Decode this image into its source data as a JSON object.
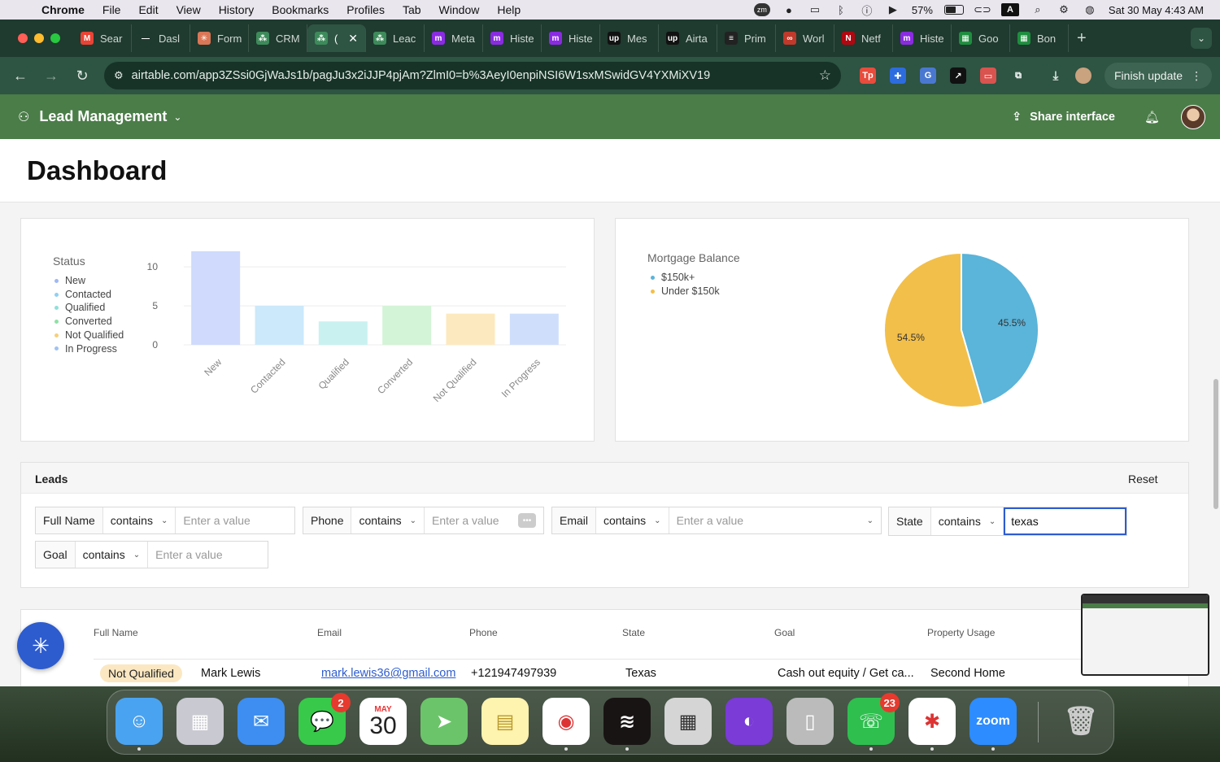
{
  "menubar": {
    "app": "Chrome",
    "items": [
      "File",
      "Edit",
      "View",
      "History",
      "Bookmarks",
      "Profiles",
      "Tab",
      "Window",
      "Help"
    ],
    "battery": "57%",
    "input_source": "A",
    "datetime": "Sat 30 May  4:43 AM",
    "zm_label": "zm"
  },
  "tabs": [
    {
      "label": "Sear",
      "icon": "gmail-icon",
      "color": "#ea4335",
      "glyph": "M"
    },
    {
      "label": "Dasl",
      "icon": "dash-icon",
      "color": "#1f3a2f",
      "glyph": "—"
    },
    {
      "label": "Form",
      "icon": "claude-icon",
      "color": "#d97757",
      "glyph": "✳"
    },
    {
      "label": "CRM",
      "icon": "airtable-icon",
      "color": "#3d8a5a",
      "glyph": "⁂"
    },
    {
      "label": "(",
      "icon": "airtable-icon",
      "color": "#3d8a5a",
      "glyph": "⁂",
      "active": true
    },
    {
      "label": "Leac",
      "icon": "airtable-icon",
      "color": "#3d8a5a",
      "glyph": "⁂"
    },
    {
      "label": "Meta",
      "icon": "make-icon",
      "color": "#8a2be2",
      "glyph": "m"
    },
    {
      "label": "Histe",
      "icon": "make-icon",
      "color": "#8a2be2",
      "glyph": "m"
    },
    {
      "label": "Histe",
      "icon": "make-icon",
      "color": "#8a2be2",
      "glyph": "m"
    },
    {
      "label": "Mes",
      "icon": "upwork-icon",
      "color": "#111",
      "glyph": "up"
    },
    {
      "label": "Airta",
      "icon": "upwork-icon",
      "color": "#111",
      "glyph": "up"
    },
    {
      "label": "Prim",
      "icon": "prime-icon",
      "color": "#222",
      "glyph": "≡"
    },
    {
      "label": "Worl",
      "icon": "link-icon",
      "color": "#c0392b",
      "glyph": "∞"
    },
    {
      "label": "Netf",
      "icon": "netflix-icon",
      "color": "#b20710",
      "glyph": "N"
    },
    {
      "label": "Histe",
      "icon": "make-icon",
      "color": "#8a2be2",
      "glyph": "m"
    },
    {
      "label": "Goo",
      "icon": "sheets-icon",
      "color": "#1e8e3e",
      "glyph": "▦"
    },
    {
      "label": "Bon",
      "icon": "sheets-icon",
      "color": "#1e8e3e",
      "glyph": "▦"
    }
  ],
  "address": {
    "url": "airtable.com/app3ZSsi0GjWaJs1b/pagJu3x2iJJP4pjAm?ZlmI0=b%3AeyI0enpiNSI6W1sxMSwidGV4YXMiXV19",
    "finish_update": "Finish update"
  },
  "extensions": [
    {
      "name": "tp-extension-icon",
      "color": "#e74c3c",
      "glyph": "Tp"
    },
    {
      "name": "puzzle-blue-icon",
      "color": "#2d6cdf",
      "glyph": "✚"
    },
    {
      "name": "translate-icon",
      "color": "#4a78d0",
      "glyph": "G"
    },
    {
      "name": "cursor-extension-icon",
      "color": "#111",
      "glyph": "↗"
    },
    {
      "name": "red-square-extension-icon",
      "color": "#d9534f",
      "glyph": "▭"
    },
    {
      "name": "extensions-puzzle-icon",
      "color": "#2e5443",
      "glyph": "⧉"
    }
  ],
  "app": {
    "title": "Lead Management",
    "share_label": "Share interface"
  },
  "page": {
    "title": "Dashboard"
  },
  "chart_data": [
    {
      "type": "bar",
      "title": "",
      "legend_title": "Status",
      "categories": [
        "New",
        "Contacted",
        "Qualified",
        "Converted",
        "Not Qualified",
        "In Progress"
      ],
      "values": [
        12,
        5,
        3,
        5,
        4,
        4
      ],
      "colors": [
        "#cfdafc",
        "#cce9fb",
        "#c9f1f0",
        "#d3f4d6",
        "#fde9bf",
        "#cfdffb"
      ],
      "legend_colors": [
        "#9fb8f5",
        "#8fd0f3",
        "#8fe0d8",
        "#8fe0a5",
        "#f6cf7b",
        "#9fc2f3"
      ],
      "yticks": [
        0,
        5,
        10
      ],
      "ylim": [
        0,
        12
      ],
      "grid": true,
      "legend_position": "left"
    },
    {
      "type": "pie",
      "title": "",
      "legend_title": "Mortgage Balance",
      "labels": [
        "$150k+",
        "Under $150k"
      ],
      "values": [
        45.5,
        54.5
      ],
      "value_labels": [
        "45.5%",
        "54.5%"
      ],
      "colors": [
        "#5bb4d9",
        "#f2bf4a"
      ],
      "legend_position": "top-left"
    }
  ],
  "leads": {
    "section_title": "Leads",
    "reset_label": "Reset",
    "filters": [
      {
        "field": "Full Name",
        "operator": "contains",
        "value": "",
        "placeholder": "Enter a value"
      },
      {
        "field": "Phone",
        "operator": "contains",
        "value": "",
        "placeholder": "Enter a value"
      },
      {
        "field": "Email",
        "operator": "contains",
        "value": "",
        "placeholder": "Enter a value"
      },
      {
        "field": "State",
        "operator": "contains",
        "value": "texas",
        "placeholder": "Enter a value"
      },
      {
        "field": "Goal",
        "operator": "contains",
        "value": "",
        "placeholder": "Enter a value"
      }
    ],
    "columns": [
      "Full Name",
      "Email",
      "Phone",
      "State",
      "Goal",
      "Property Usage"
    ],
    "rows": [
      {
        "status": "Not Qualified",
        "full_name": "Mark Lewis",
        "email": "mark.lewis36@gmail.com",
        "phone": "+121947497939",
        "state": "Texas",
        "goal": "Cash out equity / Get ca...",
        "property_usage": "Second Home"
      }
    ]
  },
  "dock": [
    {
      "name": "finder",
      "bg": "#4aa3f0",
      "glyph": "☺",
      "running": true
    },
    {
      "name": "launchpad",
      "bg": "#c9c9d1",
      "glyph": "▦",
      "running": false
    },
    {
      "name": "mail",
      "bg": "#3d8ef0",
      "glyph": "✉",
      "running": false
    },
    {
      "name": "messages",
      "bg": "#38c94a",
      "glyph": "💬",
      "badge": "2",
      "running": false
    },
    {
      "name": "calendar",
      "bg": "#ffffff",
      "glyph": "",
      "month": "MAY",
      "day": "30",
      "running": false
    },
    {
      "name": "maps",
      "bg": "#6cc46a",
      "glyph": "➤",
      "running": false
    },
    {
      "name": "notes",
      "bg": "#fff3b0",
      "glyph": "▤",
      "running": false
    },
    {
      "name": "chrome",
      "bg": "#ffffff",
      "glyph": "◉",
      "running": true
    },
    {
      "name": "spotify",
      "bg": "#191414",
      "glyph": "≋",
      "running": true
    },
    {
      "name": "calculator",
      "bg": "#d5d5d5",
      "glyph": "▦",
      "running": false
    },
    {
      "name": "firefox",
      "bg": "#7a3bd6",
      "glyph": "◐",
      "running": false
    },
    {
      "name": "iphone-mirroring",
      "bg": "#bbbbbb",
      "glyph": "▯",
      "running": false
    },
    {
      "name": "whatsapp",
      "bg": "#2fbf4f",
      "glyph": "☏",
      "badge": "23",
      "running": true
    },
    {
      "name": "slack",
      "bg": "#ffffff",
      "glyph": "✱",
      "running": true
    },
    {
      "name": "zoom",
      "bg": "#2d8cff",
      "glyph": "zoom",
      "running": true
    },
    {
      "name": "trash",
      "bg": "transparent",
      "glyph": "🗑",
      "running": false
    }
  ]
}
